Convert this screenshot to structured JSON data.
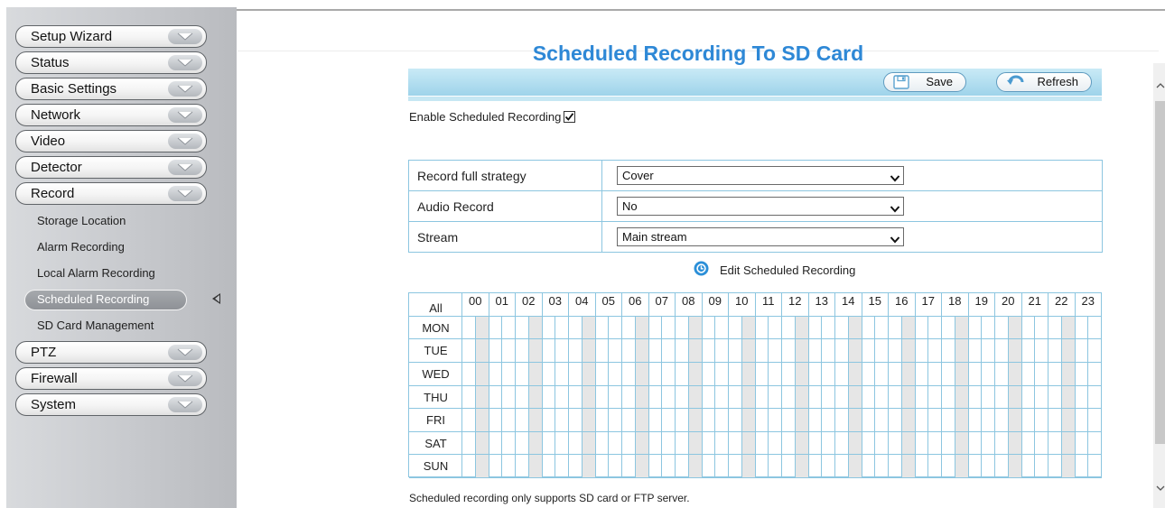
{
  "sidebar": {
    "menu": [
      {
        "label": "Setup Wizard"
      },
      {
        "label": "Status"
      },
      {
        "label": "Basic Settings"
      },
      {
        "label": "Network"
      },
      {
        "label": "Video"
      },
      {
        "label": "Detector"
      },
      {
        "label": "Record"
      }
    ],
    "record_submenu": [
      {
        "label": "Storage Location"
      },
      {
        "label": "Alarm Recording"
      },
      {
        "label": "Local Alarm Recording"
      },
      {
        "label": "Scheduled Recording",
        "active": true
      },
      {
        "label": "SD Card Management"
      }
    ],
    "menu_after": [
      {
        "label": "PTZ"
      },
      {
        "label": "Firewall"
      },
      {
        "label": "System"
      }
    ]
  },
  "page": {
    "title": "Scheduled Recording To SD Card",
    "save_label": "Save",
    "refresh_label": "Refresh",
    "enable_label": "Enable Scheduled Recording",
    "enable_checked": true,
    "edit_link_label": "Edit Scheduled Recording",
    "footer_note": "Scheduled recording only supports SD card or FTP server."
  },
  "settings": [
    {
      "label": "Record full strategy",
      "value": "Cover"
    },
    {
      "label": "Audio Record",
      "value": "No"
    },
    {
      "label": "Stream",
      "value": "Main stream"
    }
  ],
  "schedule": {
    "all_label": "All",
    "hours": [
      "00",
      "01",
      "02",
      "03",
      "04",
      "05",
      "06",
      "07",
      "08",
      "09",
      "10",
      "11",
      "12",
      "13",
      "14",
      "15",
      "16",
      "17",
      "18",
      "19",
      "20",
      "21",
      "22",
      "23"
    ],
    "days": [
      "MON",
      "TUE",
      "WED",
      "THU",
      "FRI",
      "SAT",
      "SUN"
    ]
  },
  "colors": {
    "accent": "#2e88d6",
    "grid_border": "#8cc6e0",
    "toolbar": "#9ed3ea"
  }
}
